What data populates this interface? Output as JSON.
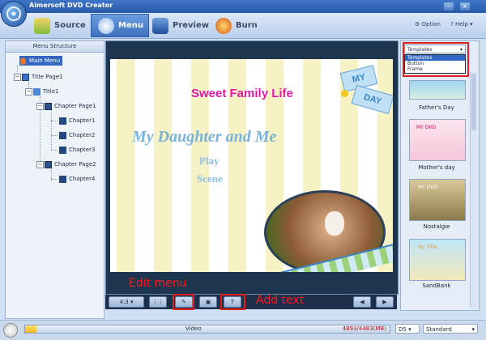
{
  "app": {
    "title": "Aimersoft DVD Creator"
  },
  "tabs": [
    {
      "label": "Source",
      "icon": "source-icon"
    },
    {
      "label": "Menu",
      "icon": "menu-icon"
    },
    {
      "label": "Preview",
      "icon": "preview-icon"
    },
    {
      "label": "Burn",
      "icon": "burn-icon"
    }
  ],
  "toolbar_right": {
    "option": "Option",
    "help": "Help"
  },
  "menu_structure": {
    "title": "Menu Structure",
    "items": [
      {
        "label": "Main Menu",
        "selected": true
      },
      {
        "label": "Title Page1"
      },
      {
        "label": "Title1"
      },
      {
        "label": "Chapter Page1"
      },
      {
        "label": "Chapter1"
      },
      {
        "label": "Chapter2"
      },
      {
        "label": "Chapter3"
      },
      {
        "label": "Chapter Page2"
      },
      {
        "label": "Chapter4"
      }
    ]
  },
  "canvas": {
    "title": "Sweet Family Life",
    "subtitle": "My Daughter and Me",
    "play": "Play",
    "scene": "Scene",
    "sticker_top": "MY",
    "sticker_bottom": "DAY"
  },
  "controls": {
    "aspect": "4:3"
  },
  "annotations": {
    "edit_menu": "Edit menu",
    "add_text": "Add text"
  },
  "templates": {
    "dropdown_value": "Templates",
    "options": [
      "Templates",
      "Button",
      "Frame"
    ],
    "items": [
      {
        "label": "Father's Day"
      },
      {
        "label": "Mother's day",
        "thumb_text": "MY DVD"
      },
      {
        "label": "Nostalgie",
        "thumb_text": "MY DVD"
      },
      {
        "label": "SandBank",
        "thumb_text": "My Title"
      }
    ]
  },
  "status": {
    "label": "Video",
    "capacity": "4893/4483(MB)",
    "fill": 0.03,
    "disc": "D5",
    "quality": "Standard"
  },
  "colors": {
    "accent": "#3a6fc2",
    "annotation": "#ff1a1a",
    "title_pink": "#e01aa8",
    "script_blue": "#7ab3d9"
  }
}
